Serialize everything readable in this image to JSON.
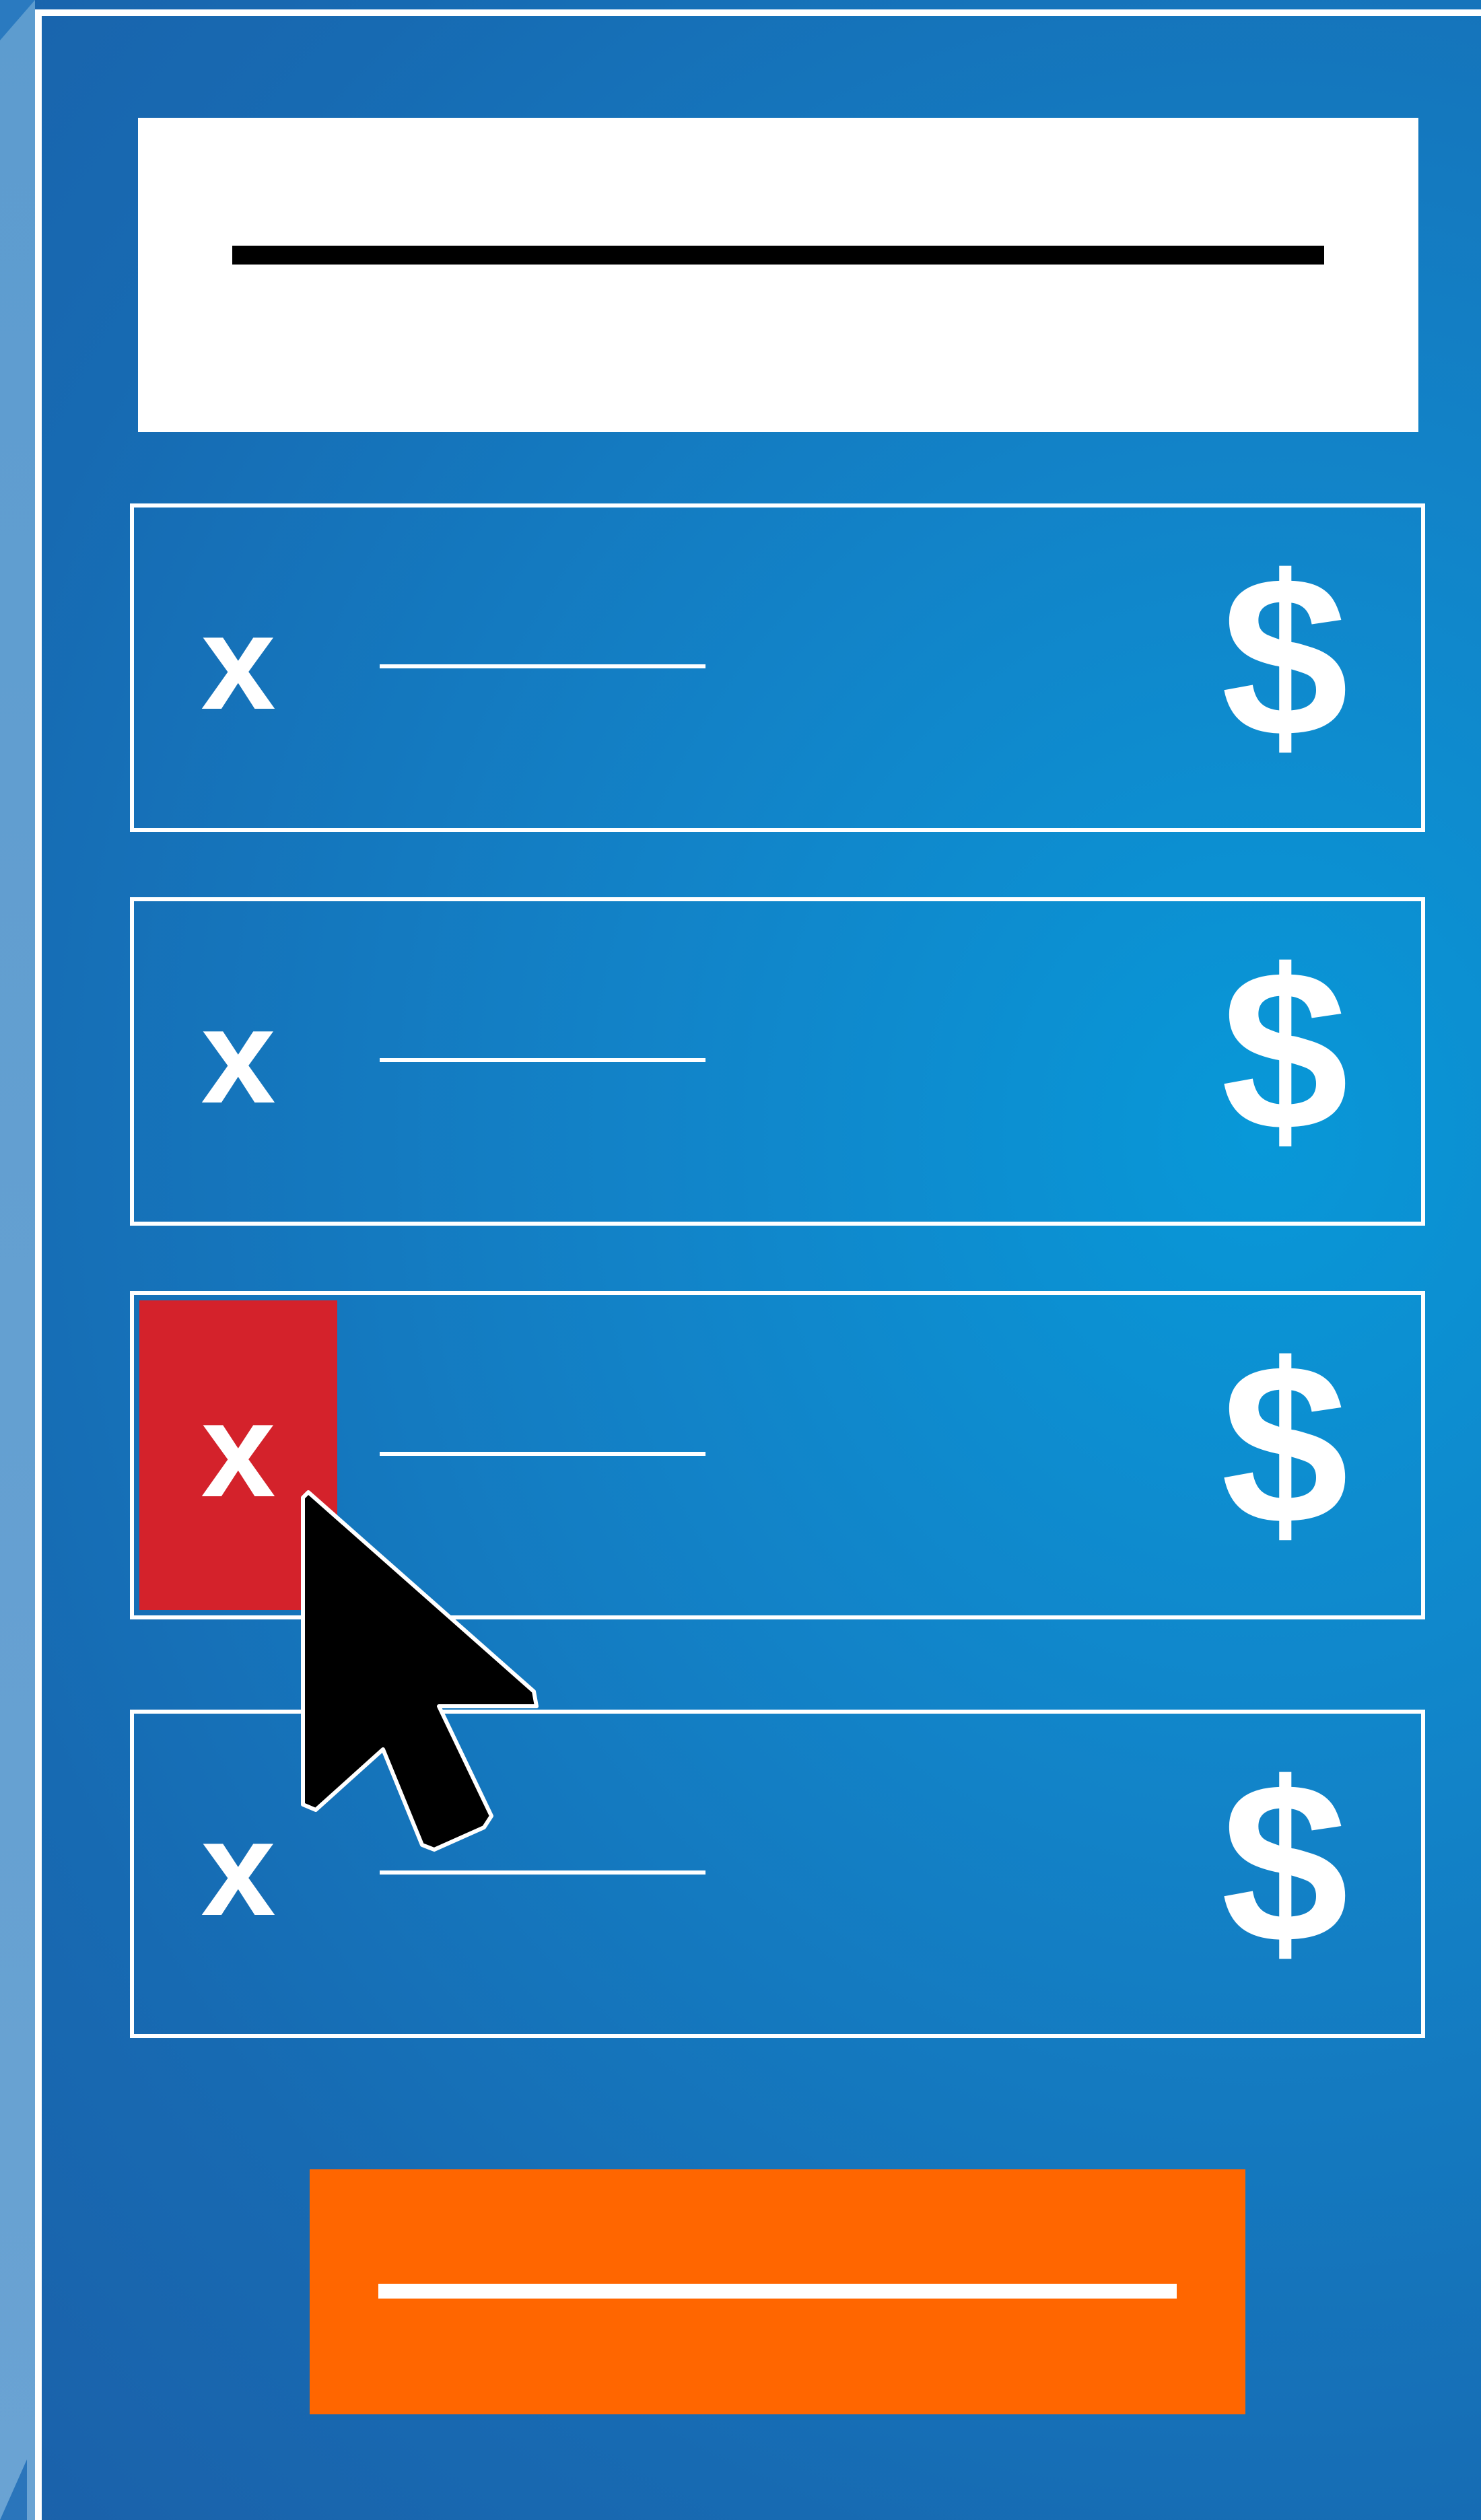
{
  "header": {
    "title_placeholder": ""
  },
  "cart": {
    "items": [
      {
        "remove_glyph": "x",
        "name_placeholder": "",
        "price_glyph": "$",
        "highlighted": false
      },
      {
        "remove_glyph": "x",
        "name_placeholder": "",
        "price_glyph": "$",
        "highlighted": false
      },
      {
        "remove_glyph": "x",
        "name_placeholder": "",
        "price_glyph": "$",
        "highlighted": true
      },
      {
        "remove_glyph": "x",
        "name_placeholder": "",
        "price_glyph": "$",
        "highlighted": false
      }
    ]
  },
  "cta": {
    "label_placeholder": ""
  },
  "colors": {
    "background": "#1a6fb5",
    "highlight_remove": "#d4222b",
    "cta": "#ff6600",
    "header_card": "#ffffff"
  },
  "icons": {
    "remove": "close-icon",
    "price": "dollar-icon",
    "pointer": "mouse-cursor-icon"
  }
}
